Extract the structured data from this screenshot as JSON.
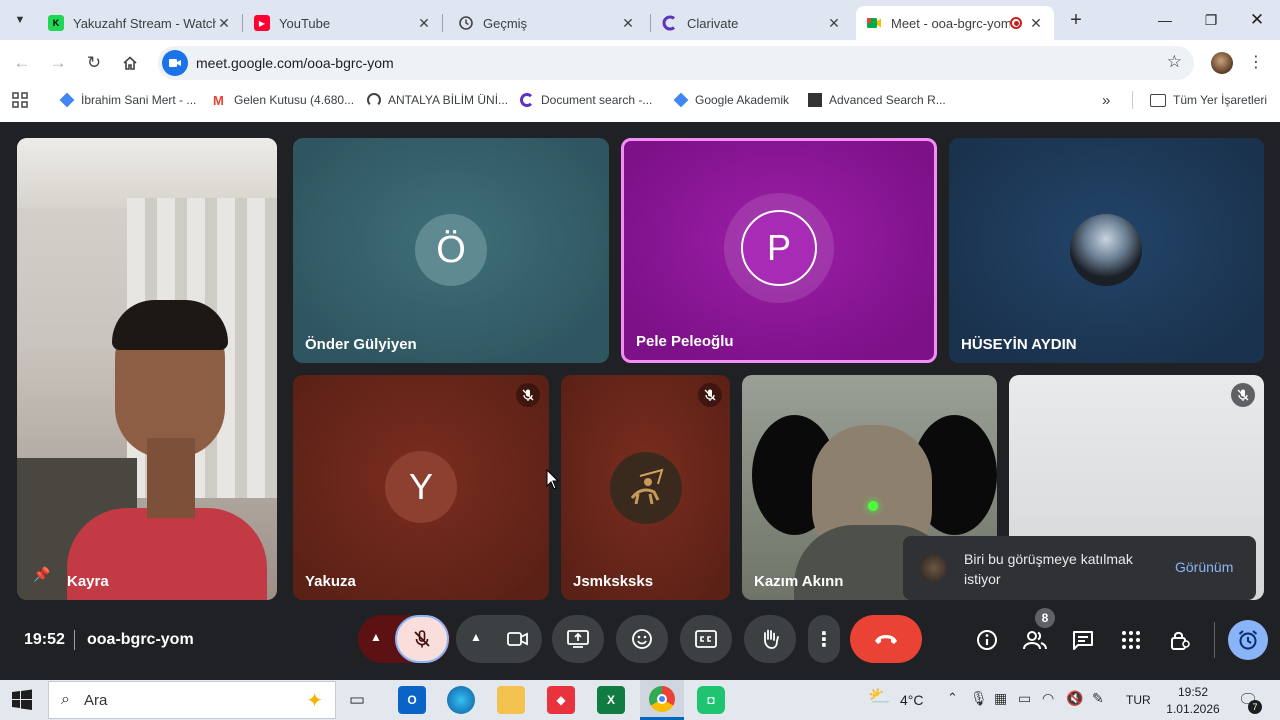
{
  "browser": {
    "tabs": [
      {
        "title": "Yakuzahf Stream - Watch",
        "fav_color": "#1fd655",
        "fav_glyph": "K"
      },
      {
        "title": "YouTube",
        "fav_color": "#ff0033",
        "fav_glyph": "▶"
      },
      {
        "title": "Geçmiş",
        "fav_color": "#5f6368",
        "fav_glyph": "history-icon"
      },
      {
        "title": "Clarivate",
        "fav_color": "#5e33bf",
        "fav_glyph": "C"
      },
      {
        "title": "Meet - ooa-bgrc-yom",
        "fav_color": "#00832d",
        "fav_glyph": "meet-icon"
      }
    ],
    "url": "meet.google.com/ooa-bgrc-yom",
    "bookmarks": [
      "İbrahim Sani Mert - ...",
      "Gelen Kutusu (4.680...",
      "ANTALYA BİLİM ÜNİ...",
      "Document search -...",
      "Google Akademik",
      "Advanced Search R..."
    ],
    "all_bookmarks": "Tüm Yer İşaretleri"
  },
  "meet": {
    "participants": [
      {
        "name": "Kayra",
        "type": "video",
        "pinned": true
      },
      {
        "name": "Önder Gülyiyen",
        "initial": "Ö",
        "color": "#3f6f78"
      },
      {
        "name": "Pele Peleoğlu",
        "initial": "P",
        "color": "#9c1fa8",
        "speaking": true
      },
      {
        "name": "HÜSEYİN AYDIN",
        "type": "avatar-image",
        "color": "#1f3b5a"
      },
      {
        "name": "Yakuza",
        "initial": "Y",
        "color": "#7a2d1f",
        "muted": true
      },
      {
        "name": "Jsmksksks",
        "type": "avatar-image",
        "color": "#7a2d1f",
        "muted": true
      },
      {
        "name": "Kazım Akınn",
        "type": "video"
      },
      {
        "name": "",
        "type": "video",
        "muted": true
      }
    ],
    "time": "19:52",
    "meeting_code": "ooa-bgrc-yom",
    "participant_count": "8",
    "toast": {
      "message": "Biri bu görüşmeye katılmak istiyor",
      "action": "Görünüm"
    },
    "colors": {
      "end_call": "#ea4335",
      "accent": "#8ab4f8",
      "mic_off": "#f9dedc"
    }
  },
  "taskbar": {
    "search_placeholder": "Ara",
    "weather": "4°C",
    "language": "TUR",
    "clock_time": "19:52",
    "clock_date": "1.01.2026",
    "notification_count": "7"
  }
}
